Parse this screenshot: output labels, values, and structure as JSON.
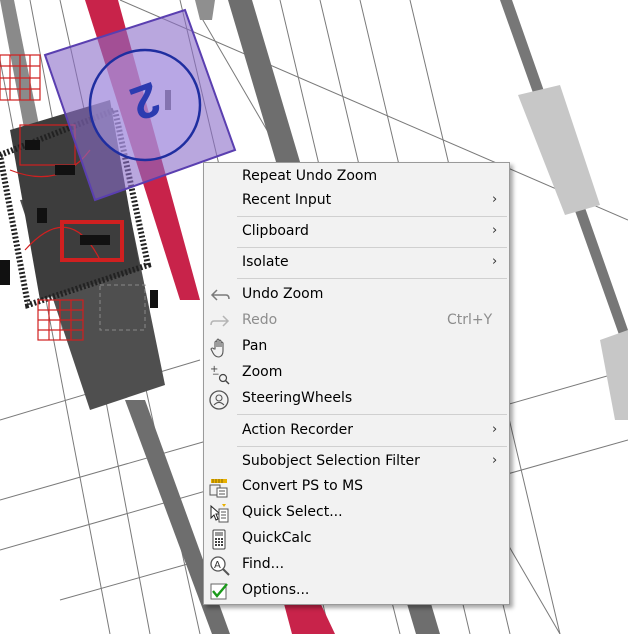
{
  "drawing": {
    "viewport_label": "2"
  },
  "context_menu": {
    "items": [
      {
        "label": "Repeat Undo Zoom",
        "shortcut": "",
        "submenu": false,
        "disabled": false,
        "icon": ""
      },
      {
        "label": "Recent Input",
        "shortcut": "",
        "submenu": true,
        "disabled": false,
        "icon": ""
      },
      {
        "label": "Clipboard",
        "shortcut": "",
        "submenu": true,
        "disabled": false,
        "icon": ""
      },
      {
        "label": "Isolate",
        "shortcut": "",
        "submenu": true,
        "disabled": false,
        "icon": ""
      },
      {
        "label": "Undo Zoom",
        "shortcut": "",
        "submenu": false,
        "disabled": false,
        "icon": "undo-arrow-icon"
      },
      {
        "label": "Redo",
        "shortcut": "Ctrl+Y",
        "submenu": false,
        "disabled": true,
        "icon": "redo-arrow-icon"
      },
      {
        "label": "Pan",
        "shortcut": "",
        "submenu": false,
        "disabled": false,
        "icon": "pan-hand-icon"
      },
      {
        "label": "Zoom",
        "shortcut": "",
        "submenu": false,
        "disabled": false,
        "icon": "zoom-magnifier-icon"
      },
      {
        "label": "SteeringWheels",
        "shortcut": "",
        "submenu": false,
        "disabled": false,
        "icon": "steering-wheel-icon"
      },
      {
        "label": "Action Recorder",
        "shortcut": "",
        "submenu": true,
        "disabled": false,
        "icon": ""
      },
      {
        "label": "Subobject Selection Filter",
        "shortcut": "",
        "submenu": true,
        "disabled": false,
        "icon": ""
      },
      {
        "label": "Convert PS to MS",
        "shortcut": "",
        "submenu": false,
        "disabled": false,
        "icon": "convert-ps-ms-icon"
      },
      {
        "label": "Quick Select...",
        "shortcut": "",
        "submenu": false,
        "disabled": false,
        "icon": "quick-select-icon"
      },
      {
        "label": "QuickCalc",
        "shortcut": "",
        "submenu": false,
        "disabled": false,
        "icon": "calculator-icon"
      },
      {
        "label": "Find...",
        "shortcut": "",
        "submenu": false,
        "disabled": false,
        "icon": "find-text-icon"
      },
      {
        "label": "Options...",
        "shortcut": "",
        "submenu": false,
        "disabled": false,
        "icon": "checkmark-icon"
      }
    ],
    "submenu_arrow": "›"
  }
}
